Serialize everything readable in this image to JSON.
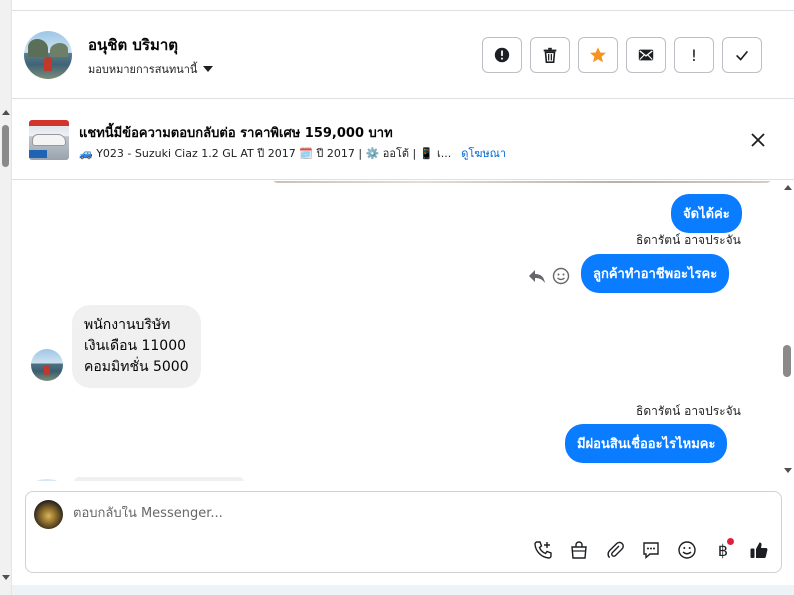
{
  "header": {
    "contact_name": "อนุชิต บริมาตุ",
    "assign_label": "มอบหมายการสนทนานี้",
    "actions": [
      {
        "icon": "alert-circle-icon",
        "name": "spam-button"
      },
      {
        "icon": "trash-icon",
        "name": "delete-button"
      },
      {
        "icon": "star-icon",
        "name": "star-button"
      },
      {
        "icon": "envelope-icon",
        "name": "mark-unread-button"
      },
      {
        "icon": "exclamation-icon",
        "name": "follow-up-button",
        "glyph": "!"
      },
      {
        "icon": "check-icon",
        "name": "mark-done-button"
      }
    ],
    "star_color": "#f7931e"
  },
  "ad": {
    "title": "แชทนี้มีข้อความตอบกลับต่อ ราคาพิเศษ 159,000 บาท",
    "meta": "🚙 Y023 - Suzuki Ciaz 1.2 GL AT ปี 2017 🗓️ ปี 2017 | ⚙️ ออโต้ | 📱 เ...",
    "link": "ดูโฆษณา"
  },
  "messages": {
    "m1_text": "จัดได้ค่ะ",
    "m2_sender": "ธิดารัตน์ อาจประจัน",
    "m2_text": "ลูกค้าทำอาชีพอะไรคะ",
    "m3_lines": [
      "พนักงานบริษัท",
      "เงินเดือน  11000",
      "คอมมิทชั่น 5000"
    ],
    "m4_sender": "ธิดารัตน์ อาจประจัน",
    "m4_text": "มีผ่อนสินเชื่ออะไรไหมคะ"
  },
  "composer": {
    "placeholder": "ตอบกลับใน Messenger...",
    "baht_glyph": "฿"
  },
  "colors": {
    "accent": "#0a7cff",
    "link": "#0064d1",
    "notification_dot": "#e41e3f"
  }
}
